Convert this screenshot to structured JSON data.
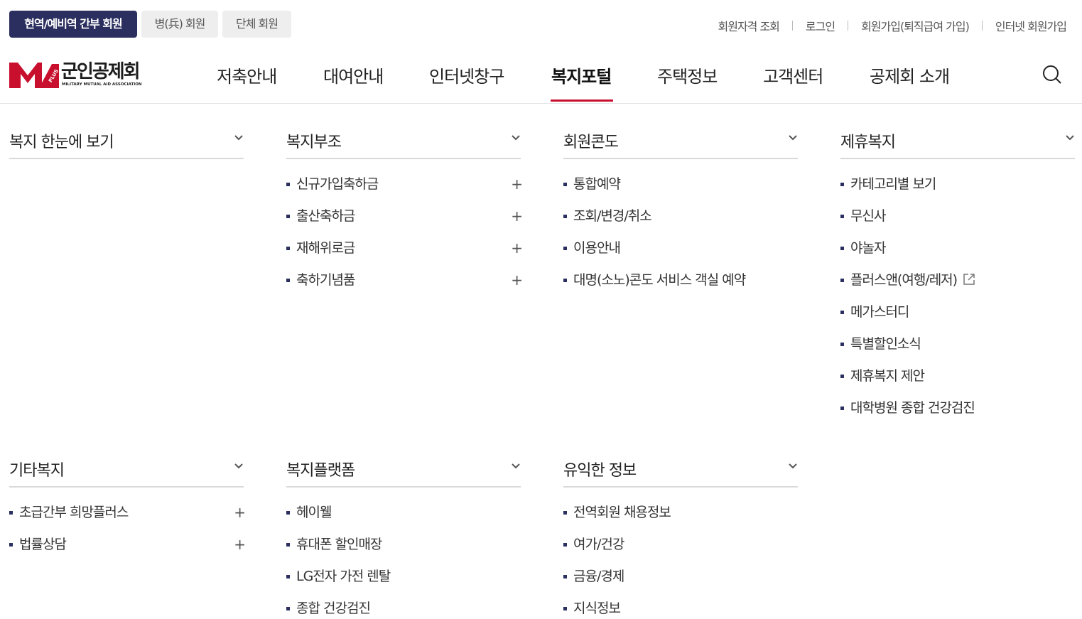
{
  "member_tabs": [
    "현역/예비역 간부 회원",
    "병(兵) 회원",
    "단체 회원"
  ],
  "util_links": [
    "회원자격 조회",
    "로그인",
    "회원가입(퇴직급여 가입)",
    "인터넷 회원가입"
  ],
  "logo": {
    "name": "군인공제회",
    "sub": "MILITARY MUTUAL AID ASSOCIATION",
    "badge": "PLUS"
  },
  "gnb": [
    "저축안내",
    "대여안내",
    "인터넷창구",
    "복지포털",
    "주택정보",
    "고객센터",
    "공제회 소개"
  ],
  "active_menu": "복지포털",
  "colors": {
    "navy": "#2b2f5f",
    "accent_red": "#c8102e"
  },
  "categories": [
    {
      "title": "복지 한눈에 보기",
      "items": []
    },
    {
      "title": "복지부조",
      "items": [
        {
          "label": "신규가입축하금",
          "plus": "+"
        },
        {
          "label": "출산축하금",
          "plus": "+"
        },
        {
          "label": "재해위로금",
          "plus": "+"
        },
        {
          "label": "축하기념품",
          "plus": "+"
        }
      ]
    },
    {
      "title": "회원콘도",
      "items": [
        {
          "label": "통합예약"
        },
        {
          "label": "조회/변경/취소"
        },
        {
          "label": "이용안내"
        },
        {
          "label": "대명(소노)콘도 서비스 객실 예약"
        }
      ]
    },
    {
      "title": "제휴복지",
      "items": [
        {
          "label": "카테고리별 보기"
        },
        {
          "label": "무신사"
        },
        {
          "label": "야놀자"
        },
        {
          "label": "플러스앤(여행/레저)",
          "external": true
        },
        {
          "label": "메가스터디"
        },
        {
          "label": "특별할인소식"
        },
        {
          "label": "제휴복지 제안"
        },
        {
          "label": "대학병원 종합 건강검진"
        }
      ]
    },
    {
      "title": "기타복지",
      "items": [
        {
          "label": "초급간부 희망플러스",
          "plus": "+"
        },
        {
          "label": "법률상담",
          "plus": "+"
        }
      ]
    },
    {
      "title": "복지플랫폼",
      "items": [
        {
          "label": "헤이웰"
        },
        {
          "label": "휴대폰 할인매장"
        },
        {
          "label": "LG전자 가전 렌탈"
        },
        {
          "label": "종합 건강검진"
        }
      ]
    },
    {
      "title": "유익한 정보",
      "items": [
        {
          "label": "전역회원 채용정보"
        },
        {
          "label": "여가/건강"
        },
        {
          "label": "금융/경제"
        },
        {
          "label": "지식정보"
        }
      ]
    }
  ]
}
